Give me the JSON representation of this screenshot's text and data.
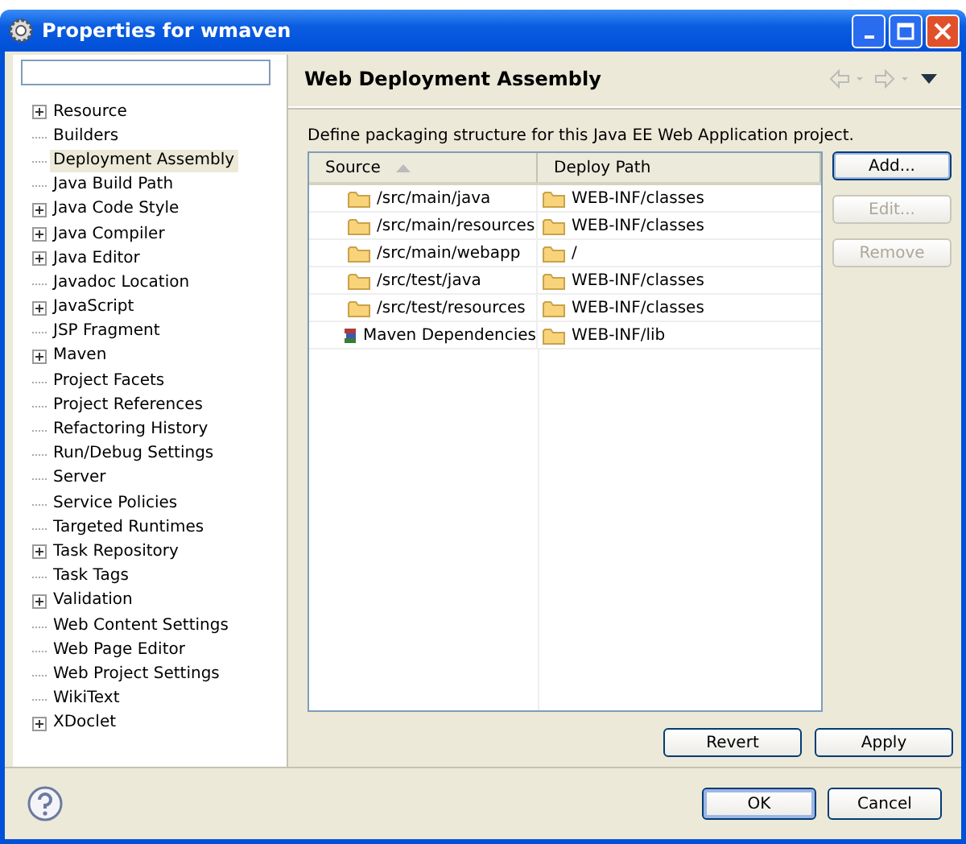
{
  "window": {
    "title": "Properties for wmaven"
  },
  "tree": [
    {
      "label": "Resource",
      "expandable": true,
      "selected": false
    },
    {
      "label": "Builders",
      "expandable": false,
      "selected": false
    },
    {
      "label": "Deployment Assembly",
      "expandable": false,
      "selected": true
    },
    {
      "label": "Java Build Path",
      "expandable": false,
      "selected": false
    },
    {
      "label": "Java Code Style",
      "expandable": true,
      "selected": false
    },
    {
      "label": "Java Compiler",
      "expandable": true,
      "selected": false
    },
    {
      "label": "Java Editor",
      "expandable": true,
      "selected": false
    },
    {
      "label": "Javadoc Location",
      "expandable": false,
      "selected": false
    },
    {
      "label": "JavaScript",
      "expandable": true,
      "selected": false
    },
    {
      "label": "JSP Fragment",
      "expandable": false,
      "selected": false
    },
    {
      "label": "Maven",
      "expandable": true,
      "selected": false
    },
    {
      "label": "Project Facets",
      "expandable": false,
      "selected": false
    },
    {
      "label": "Project References",
      "expandable": false,
      "selected": false
    },
    {
      "label": "Refactoring History",
      "expandable": false,
      "selected": false
    },
    {
      "label": "Run/Debug Settings",
      "expandable": false,
      "selected": false
    },
    {
      "label": "Server",
      "expandable": false,
      "selected": false
    },
    {
      "label": "Service Policies",
      "expandable": false,
      "selected": false
    },
    {
      "label": "Targeted Runtimes",
      "expandable": false,
      "selected": false
    },
    {
      "label": "Task Repository",
      "expandable": true,
      "selected": false
    },
    {
      "label": "Task Tags",
      "expandable": false,
      "selected": false
    },
    {
      "label": "Validation",
      "expandable": true,
      "selected": false
    },
    {
      "label": "Web Content Settings",
      "expandable": false,
      "selected": false
    },
    {
      "label": "Web Page Editor",
      "expandable": false,
      "selected": false
    },
    {
      "label": "Web Project Settings",
      "expandable": false,
      "selected": false
    },
    {
      "label": "WikiText",
      "expandable": false,
      "selected": false
    },
    {
      "label": "XDoclet",
      "expandable": true,
      "selected": false
    }
  ],
  "page": {
    "title": "Web Deployment Assembly",
    "description": "Define packaging structure for this Java EE Web Application project."
  },
  "table": {
    "columns": [
      "Source",
      "Deploy Path"
    ],
    "rows": [
      {
        "kind": "folder",
        "source": "/src/main/java",
        "path": "WEB-INF/classes"
      },
      {
        "kind": "folder",
        "source": "/src/main/resources",
        "path": "WEB-INF/classes"
      },
      {
        "kind": "folder",
        "source": "/src/main/webapp",
        "path": "/"
      },
      {
        "kind": "folder",
        "source": "/src/test/java",
        "path": "WEB-INF/classes"
      },
      {
        "kind": "folder",
        "source": "/src/test/resources",
        "path": "WEB-INF/classes"
      },
      {
        "kind": "library",
        "source": "Maven Dependencies",
        "path": "WEB-INF/lib"
      }
    ]
  },
  "side_buttons": [
    {
      "label": "Add...",
      "disabled": false
    },
    {
      "label": "Edit...",
      "disabled": true
    },
    {
      "label": "Remove",
      "disabled": true
    }
  ],
  "page_buttons": [
    "Revert",
    "Apply"
  ],
  "dialog_buttons": [
    {
      "label": "OK",
      "default": true
    },
    {
      "label": "Cancel",
      "default": false
    }
  ]
}
